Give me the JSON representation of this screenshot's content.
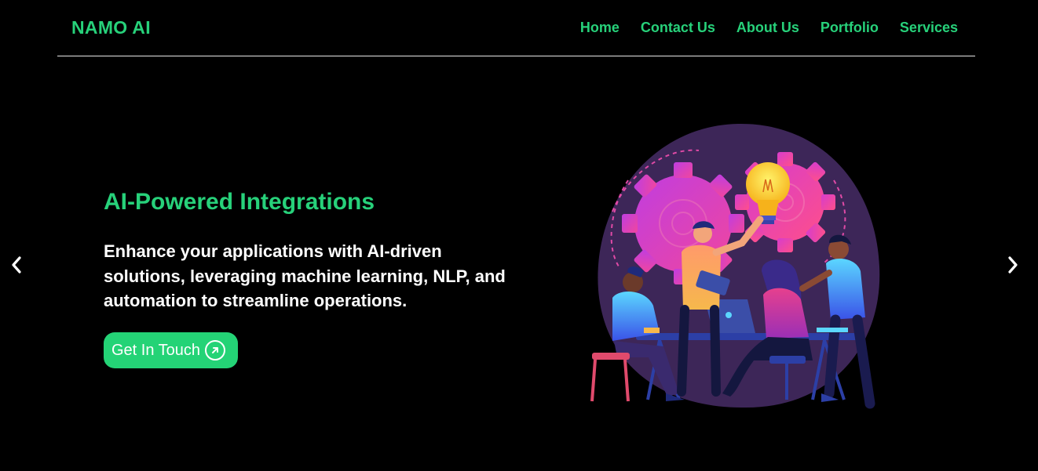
{
  "brand": {
    "name": "NAMO AI"
  },
  "nav": {
    "items": [
      "Home",
      "Contact Us",
      "About Us",
      "Portfolio",
      "Services"
    ]
  },
  "hero": {
    "title": "AI-Powered Integrations",
    "description": "Enhance your applications with AI-driven solutions, leveraging machine learning, NLP, and automation to streamline operations.",
    "cta_label": "Get In Touch"
  },
  "carousel": {
    "prev_icon": "chevron-left-icon",
    "next_icon": "chevron-right-icon"
  },
  "colors": {
    "accent": "#27d17a",
    "button": "#24d376",
    "background": "#000000",
    "text": "#ffffff"
  }
}
